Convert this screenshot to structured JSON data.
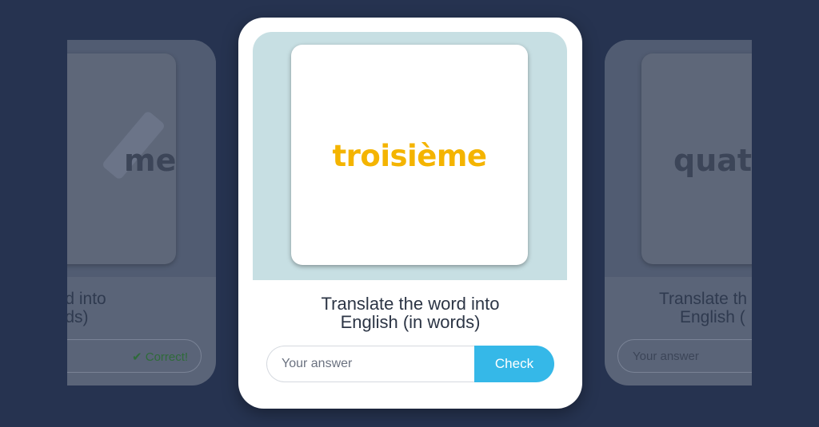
{
  "previous_card": {
    "word_fragment": "me",
    "prompt_line1": "e word into",
    "prompt_line2": "n words)",
    "status": "Correct!",
    "status_icon": "check-icon"
  },
  "current_card": {
    "word": "troisième",
    "prompt_line1": "Translate the word into",
    "prompt_line2": "English (in words)",
    "answer_value": "",
    "answer_placeholder": "Your answer",
    "check_label": "Check"
  },
  "next_card": {
    "word_fragment": "quatr",
    "prompt_line1": "Translate th",
    "prompt_line2": "English (",
    "answer_placeholder": "Your answer"
  },
  "colors": {
    "background": "#263350",
    "word_accent": "#f4b400",
    "check_button": "#35b8e8",
    "correct_status": "#2f6b3a"
  }
}
